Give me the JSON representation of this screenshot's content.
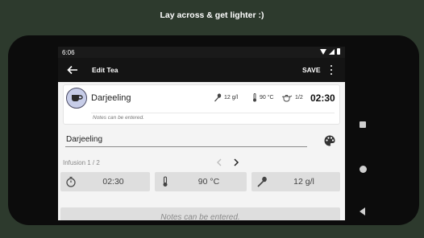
{
  "caption": "Lay across & get lighter :)",
  "status_bar": {
    "time": "6:06"
  },
  "app_bar": {
    "title": "Edit Tea",
    "save_label": "SAVE"
  },
  "tea_card": {
    "name": "Darjeeling",
    "amount": "12 g/l",
    "temperature": "90 °C",
    "infusion": "1/2",
    "time": "02:30",
    "notes": "Notes can be entered."
  },
  "name_field": {
    "value": "Darjeeling"
  },
  "infusion": {
    "label": "Infusion  1 / 2",
    "time": "02:30",
    "temperature": "90 °C",
    "amount": "12 g/l"
  },
  "notes_field": {
    "placeholder": "Notes can be entered."
  },
  "colors": {
    "accent": "#c7cde8",
    "background": "#2d3a2d"
  }
}
